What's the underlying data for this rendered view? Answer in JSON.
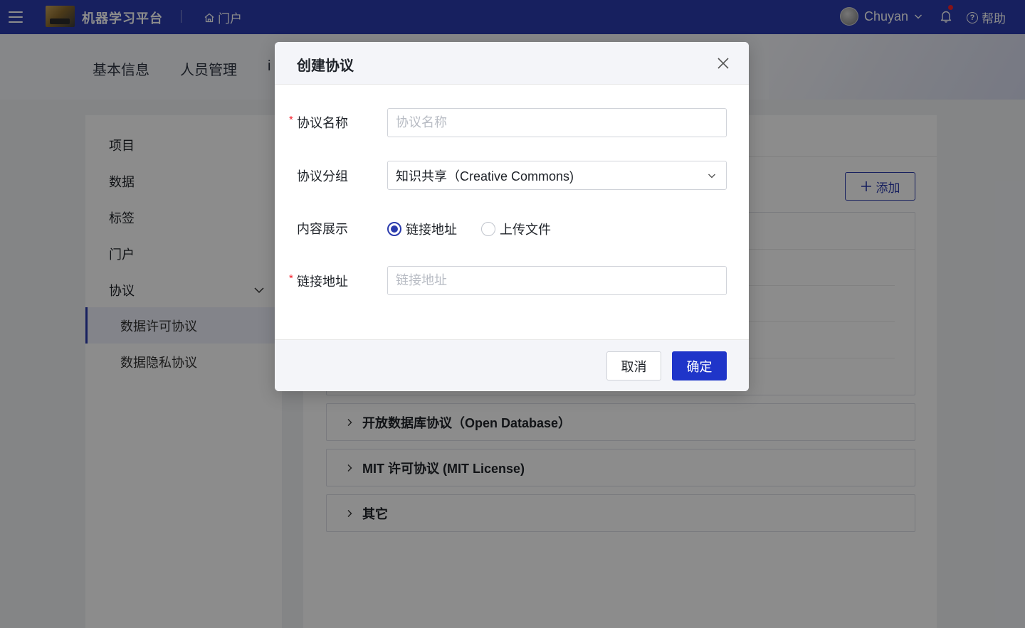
{
  "topbar": {
    "app_title": "机器学习平台",
    "portal_label": "门户",
    "user_name": "Chuyan",
    "help_label": "帮助"
  },
  "tabs": [
    {
      "label": "基本信息"
    },
    {
      "label": "人员管理"
    },
    {
      "label": "i"
    }
  ],
  "sidebar": {
    "items": [
      {
        "label": "项目"
      },
      {
        "label": "数据"
      },
      {
        "label": "标签"
      },
      {
        "label": "门户"
      },
      {
        "label": "协议"
      }
    ],
    "sub_items": [
      {
        "label": "数据许可协议",
        "active": true
      },
      {
        "label": "数据隐私协议",
        "active": false
      }
    ]
  },
  "main": {
    "add_button_label": "添加",
    "collapse_items": [
      {
        "label": "开放数据库协议（Open Database）"
      },
      {
        "label": "MIT 许可协议 (MIT License)"
      },
      {
        "label": "其它"
      }
    ]
  },
  "modal": {
    "title": "创建协议",
    "fields": {
      "name": {
        "label": "协议名称",
        "required": true,
        "placeholder": "协议名称",
        "value": ""
      },
      "group": {
        "label": "协议分组",
        "value": "知识共享（Creative Commons)"
      },
      "display": {
        "label": "内容展示",
        "options": [
          {
            "label": "链接地址",
            "checked": true
          },
          {
            "label": "上传文件",
            "checked": false
          }
        ]
      },
      "link": {
        "label": "链接地址",
        "required": true,
        "placeholder": "链接地址",
        "value": ""
      }
    },
    "cancel_label": "取消",
    "ok_label": "确定"
  },
  "colors": {
    "brand": "#2b3bad",
    "primary_button": "#1f35c9",
    "required_mark": "#f5222d",
    "notification_dot": "#f5222d"
  }
}
